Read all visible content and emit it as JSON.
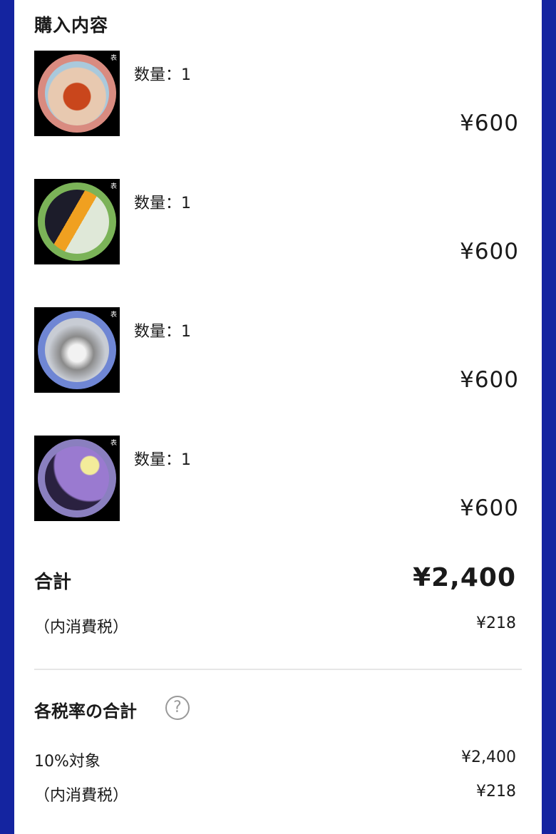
{
  "purchase": {
    "title": "購入内容",
    "items": [
      {
        "corner_label": "表",
        "quantity_text": "数量：1",
        "price": "¥600",
        "image": "hermit-crab-coin",
        "ring_color": "#d98b80"
      },
      {
        "corner_label": "表",
        "quantity_text": "数量：1",
        "price": "¥600",
        "image": "toucan-coin",
        "ring_color": "#7bb358"
      },
      {
        "corner_label": "表",
        "quantity_text": "数量：1",
        "price": "¥600",
        "image": "wolf-coin",
        "ring_color": "#6f86d4"
      },
      {
        "corner_label": "表",
        "quantity_text": "数量：1",
        "price": "¥600",
        "image": "haunted-house-coin",
        "ring_color": "#8a7fbf"
      }
    ]
  },
  "summary": {
    "total_label": "合計",
    "total_value": "¥2,400",
    "tax_label": "（内消費税）",
    "tax_value": "¥218"
  },
  "tax_rates": {
    "title": "各税率の合計",
    "help_icon": "question-circle-icon",
    "help_glyph": "?",
    "rate_label": "10%対象",
    "rate_value": "¥2,400",
    "rate_tax_label": "（内消費税）",
    "rate_tax_value": "¥218"
  },
  "colors": {
    "frame_blue": "#1424a0",
    "panel": "#ffffff"
  }
}
